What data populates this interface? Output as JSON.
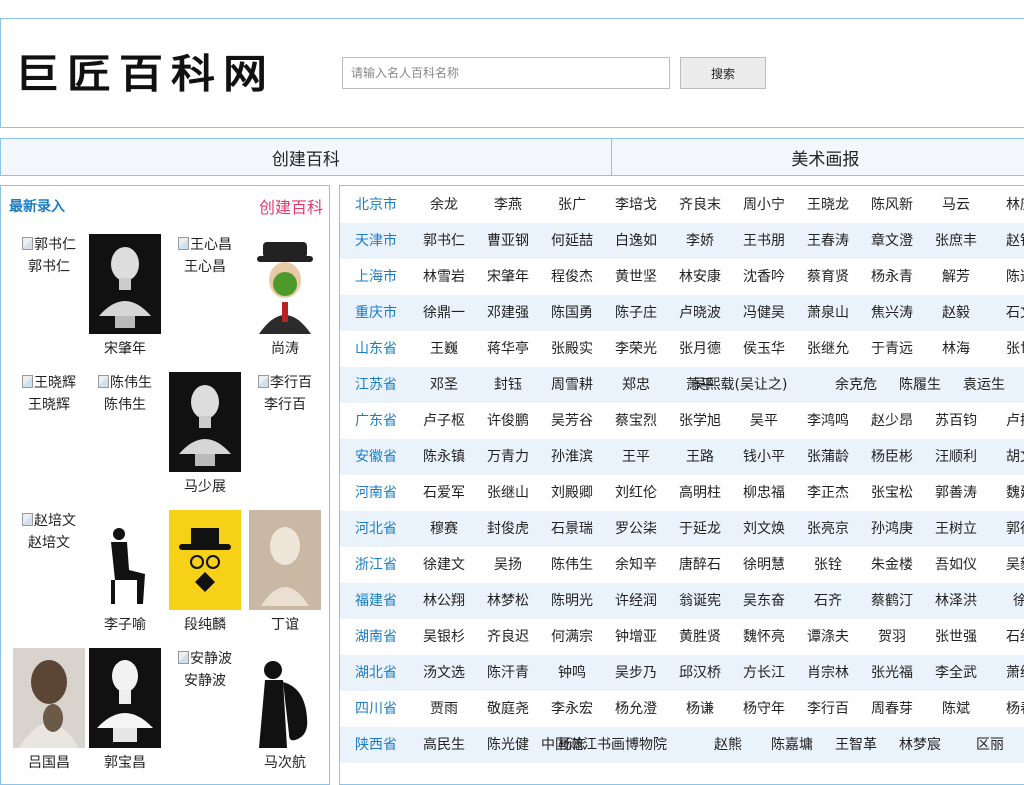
{
  "header": {
    "logo_text": "巨匠百科网",
    "search_placeholder": "请输入名人百科名称",
    "search_button": "搜索"
  },
  "nav": {
    "items": [
      "创建百科",
      "美术画报"
    ]
  },
  "sidebar": {
    "latest_label": "最新录入",
    "create_label": "创建百科",
    "people": [
      {
        "name": "郭书仁",
        "image": "broken"
      },
      {
        "name": "宋肇年",
        "image": "bust-dark"
      },
      {
        "name": "王心昌",
        "image": "broken"
      },
      {
        "name": "尚涛",
        "image": "apple-face"
      },
      {
        "name": "王晓辉",
        "image": "broken"
      },
      {
        "name": "陈伟生",
        "image": "broken"
      },
      {
        "name": "马少展",
        "image": "bust-dark"
      },
      {
        "name": "李行百",
        "image": "broken"
      },
      {
        "name": "赵培文",
        "image": "broken"
      },
      {
        "name": "李子喻",
        "image": "silhouette-sitting"
      },
      {
        "name": "段纯麟",
        "image": "hat-yellow"
      },
      {
        "name": "丁谊",
        "image": "bust-beige"
      },
      {
        "name": "吕国昌",
        "image": "hair-photo"
      },
      {
        "name": "郭宝昌",
        "image": "bust-white"
      },
      {
        "name": "安静波",
        "image": "broken"
      },
      {
        "name": "马次航",
        "image": "saxophone"
      }
    ]
  },
  "grid": {
    "rows": [
      {
        "province": "北京市",
        "names": [
          "余龙",
          "李燕",
          "张广",
          "李培戈",
          "齐良末",
          "周小宁",
          "王晓龙",
          "陈风新",
          "马云",
          "林庆"
        ]
      },
      {
        "province": "天津市",
        "names": [
          "郭书仁",
          "曹亚钢",
          "何延喆",
          "白逸如",
          "李娇",
          "王书朋",
          "王春涛",
          "章文澄",
          "张庶丰",
          "赵铁"
        ]
      },
      {
        "province": "上海市",
        "names": [
          "林雪岩",
          "宋肇年",
          "程俊杰",
          "黄世坚",
          "林安康",
          "沈香吟",
          "蔡育贤",
          "杨永青",
          "解芳",
          "陈逸"
        ]
      },
      {
        "province": "重庆市",
        "names": [
          "徐鼎一",
          "邓建强",
          "陈国勇",
          "陈子庄",
          "卢晓波",
          "冯健吴",
          "萧泉山",
          "焦兴涛",
          "赵毅",
          "石文"
        ]
      },
      {
        "province": "山东省",
        "names": [
          "王巍",
          "蒋华亭",
          "张殿实",
          "李荣光",
          "张月德",
          "侯玉华",
          "张继允",
          "于青远",
          "林海",
          "张世"
        ]
      },
      {
        "province": "江苏省",
        "names": [
          "邓圣",
          "封钰",
          "周雪耕",
          "郑忠",
          "萧平",
          "吴熙载(吴让之)",
          "余克危",
          "陈履生",
          "袁运生",
          ""
        ]
      },
      {
        "province": "广东省",
        "names": [
          "卢子枢",
          "许俊鹏",
          "吴芳谷",
          "蔡宝烈",
          "张学旭",
          "吴平",
          "李鸿鸣",
          "赵少昂",
          "苏百钧",
          "卢振"
        ]
      },
      {
        "province": "安徽省",
        "names": [
          "陈永镇",
          "万青力",
          "孙淮滨",
          "王平",
          "王路",
          "钱小平",
          "张蒲龄",
          "杨臣彬",
          "汪顺利",
          "胡文"
        ]
      },
      {
        "province": "河南省",
        "names": [
          "石爱军",
          "张继山",
          "刘殿卿",
          "刘红伦",
          "高明柱",
          "柳忠福",
          "李正杰",
          "张宝松",
          "郭善涛",
          "魏建"
        ]
      },
      {
        "province": "河北省",
        "names": [
          "穆赛",
          "封俊虎",
          "石景瑞",
          "罗公柒",
          "于延龙",
          "刘文焕",
          "张亮京",
          "孙鸿庚",
          "王树立",
          "郭德"
        ]
      },
      {
        "province": "浙江省",
        "names": [
          "徐建文",
          "吴扬",
          "陈伟生",
          "余知辛",
          "唐醉石",
          "徐明慧",
          "张铨",
          "朱金楼",
          "吾如仪",
          "吴毅"
        ]
      },
      {
        "province": "福建省",
        "names": [
          "林公翔",
          "林梦松",
          "陈明光",
          "许经润",
          "翁诞宪",
          "吴东奋",
          "石齐",
          "蔡鹤汀",
          "林泽洪",
          "徐"
        ]
      },
      {
        "province": "湖南省",
        "names": [
          "吴银杉",
          "齐良迟",
          "何满宗",
          "钟增亚",
          "黄胜贤",
          "魏怀亮",
          "谭涤夫",
          "贺羽",
          "张世强",
          "石红"
        ]
      },
      {
        "province": "湖北省",
        "names": [
          "汤文选",
          "陈汗青",
          "钟鸣",
          "吴步乃",
          "邱汉桥",
          "方长江",
          "肖宗林",
          "张光福",
          "李全武",
          "萧继"
        ]
      },
      {
        "province": "四川省",
        "names": [
          "贾雨",
          "敬庭尧",
          "李永宏",
          "杨允澄",
          "杨谦",
          "杨守年",
          "李行百",
          "周春芽",
          "陈斌",
          "杨春"
        ]
      },
      {
        "province": "陕西省",
        "names": [
          "高民生",
          "陈光健",
          "杨志",
          "中国瀚江书画博物院",
          "赵熊",
          "陈嘉墉",
          "王智革",
          "林梦宸",
          "区丽"
        ]
      }
    ]
  }
}
